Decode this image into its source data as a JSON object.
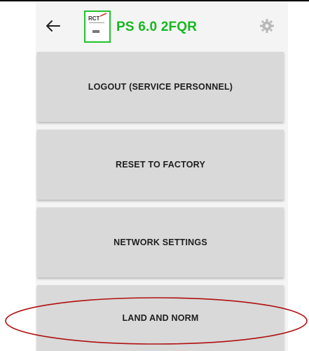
{
  "header": {
    "device_title": "PS 6.0 2FQR",
    "logo_text": "RCT"
  },
  "menu": {
    "items": [
      {
        "label": "LOGOUT (SERVICE PERSONNEL)"
      },
      {
        "label": "RESET TO FACTORY"
      },
      {
        "label": "NETWORK SETTINGS"
      },
      {
        "label": "LAND AND NORM"
      }
    ]
  },
  "icons": {
    "back": "arrow-left-icon",
    "settings": "gear-icon"
  },
  "colors": {
    "title_green": "#16b81f",
    "logo_border": "#22c32b",
    "button_bg": "#d9d9d9",
    "highlight_ellipse": "#b01010"
  }
}
